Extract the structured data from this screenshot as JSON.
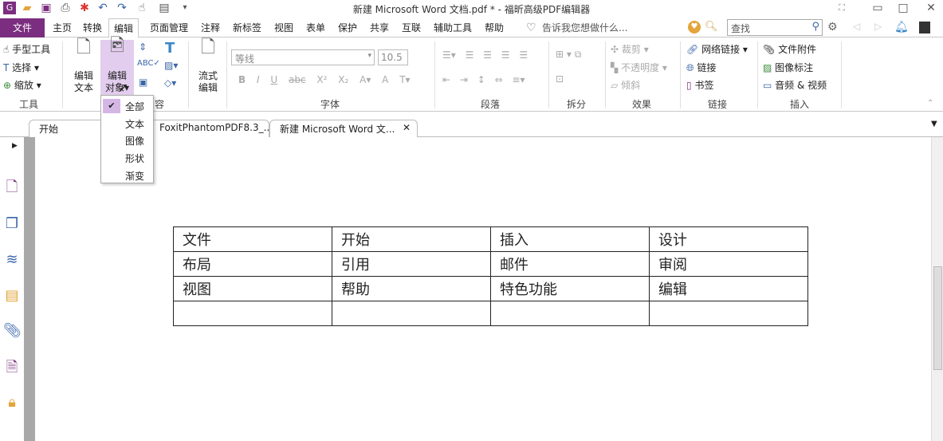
{
  "window": {
    "title": "新建 Microsoft Word 文档.pdf * - 福昕高级PDF编辑器"
  },
  "menu": {
    "file": "文件",
    "tabs": [
      "主页",
      "转换",
      "编辑",
      "页面管理",
      "注释",
      "新标签",
      "视图",
      "表单",
      "保护",
      "共享",
      "互联",
      "辅助工具",
      "帮助"
    ],
    "tell_me": "告诉我您想做什么...",
    "search_placeholder": "查找"
  },
  "ribbon": {
    "tools": {
      "hand": "手型工具",
      "select": "选择",
      "zoom": "缩放",
      "label": "工具"
    },
    "content": {
      "edit_text": [
        "编辑",
        "文本"
      ],
      "edit_object": [
        "编辑",
        "对象"
      ],
      "flow_edit": [
        "流式",
        "编辑"
      ],
      "label_partial": "容"
    },
    "font": {
      "font_name": "等线",
      "font_size": "10.5",
      "label": "字体"
    },
    "paragraph": {
      "label": "段落"
    },
    "split": {
      "label": "拆分"
    },
    "effects": {
      "crop": "裁剪",
      "opacity": "不透明度",
      "skew": "倾斜",
      "label": "效果"
    },
    "links": {
      "web_link": "网络链接",
      "link": "链接",
      "bookmark": "书签",
      "label": "链接"
    },
    "insert": {
      "file_attachment": "文件附件",
      "image_annotation": "图像标注",
      "audio_video": "音频 & 视频",
      "label": "插入"
    }
  },
  "dropdown": {
    "items": [
      "全部",
      "文本",
      "图像",
      "形状",
      "渐变"
    ],
    "selected": "全部"
  },
  "doc_tabs": [
    "开始",
    "FoxitPhantomPDF8.3_...",
    "新建 Microsoft Word 文..."
  ],
  "table": [
    [
      "文件",
      "开始",
      "插入",
      "设计"
    ],
    [
      "布局",
      "引用",
      "邮件",
      "审阅"
    ],
    [
      "视图",
      "帮助",
      "特色功能",
      "编辑"
    ],
    [
      "",
      "",
      "",
      ""
    ]
  ],
  "colors": {
    "accent": "#7b2e7f",
    "highlight": "#d4b6e4"
  }
}
